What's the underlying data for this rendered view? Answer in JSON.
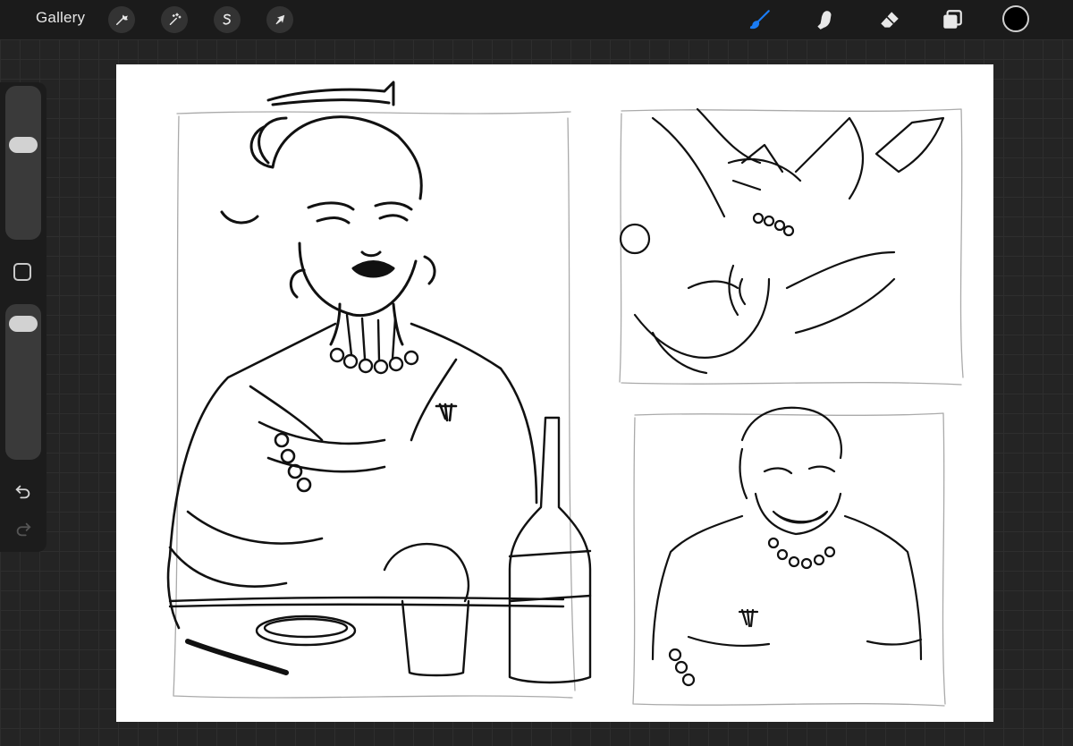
{
  "topbar": {
    "gallery_label": "Gallery",
    "left_tools": [
      {
        "name": "actions-tool",
        "icon": "wrench-icon"
      },
      {
        "name": "adjustments-tool",
        "icon": "magic-wand-icon"
      },
      {
        "name": "selection-tool",
        "icon": "selection-s-icon"
      },
      {
        "name": "transform-tool",
        "icon": "arrow-cursor-icon"
      }
    ],
    "right_tools": [
      {
        "name": "brush-tool",
        "icon": "brush-icon",
        "active": true
      },
      {
        "name": "smudge-tool",
        "icon": "smudge-finger-icon"
      },
      {
        "name": "eraser-tool",
        "icon": "eraser-icon"
      },
      {
        "name": "layers-tool",
        "icon": "layers-icon"
      }
    ],
    "current_color": "#000000",
    "accent_color": "#1a7cf5"
  },
  "sidebar": {
    "brush_size_level": 0.64,
    "brush_opacity_level": 0.94,
    "modifier_icon": "square-icon",
    "undo_icon": "undo-arrow-icon",
    "redo_icon": "redo-arrow-icon"
  },
  "canvas": {
    "background": "#ffffff",
    "content": "sketch-drawing"
  }
}
